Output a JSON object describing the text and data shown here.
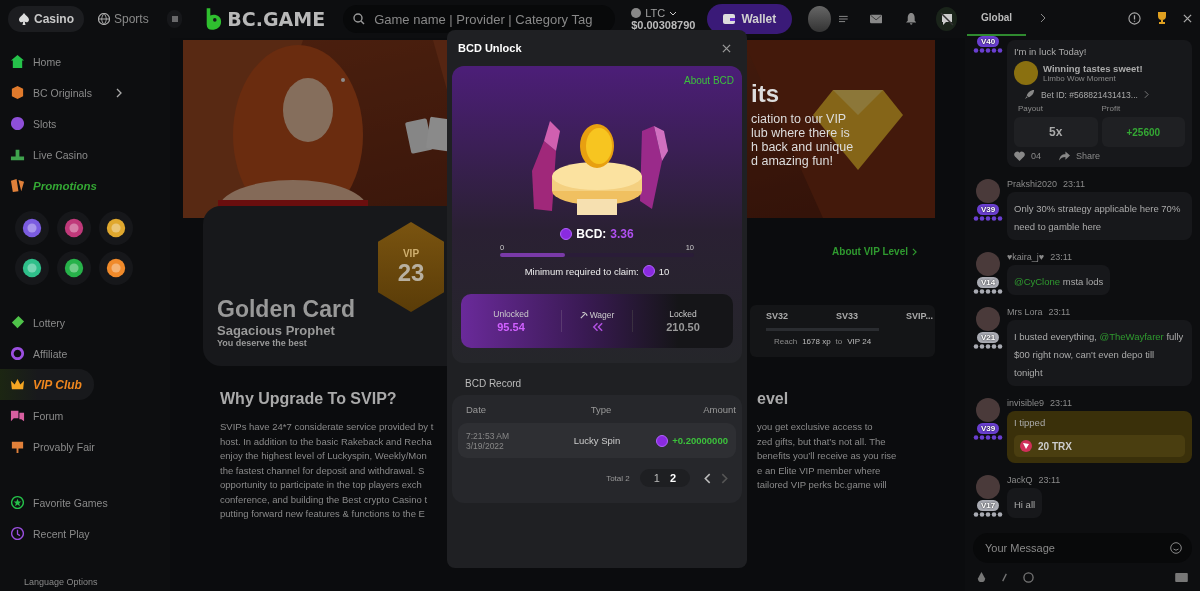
{
  "header": {
    "nav_tabs": [
      {
        "label": "Casino",
        "selected": true
      },
      {
        "label": "Sports",
        "selected": false
      }
    ],
    "logo": "BC.GAME",
    "search": {
      "placeholder": "Game name | Provider | Category Tag"
    },
    "currency": "LTC",
    "balance": "$0.00308790",
    "wallet_button": "Wallet"
  },
  "sidebar": {
    "main_items": [
      {
        "label": "Home",
        "kind": "plain",
        "expandable": false,
        "selected": false
      },
      {
        "label": "BC Originals",
        "kind": "plain",
        "expandable": true,
        "selected": false
      },
      {
        "label": "Slots",
        "kind": "plain",
        "expandable": false,
        "selected": false
      },
      {
        "label": "Live Casino",
        "kind": "plain",
        "expandable": false,
        "selected": false
      },
      {
        "label": "Promotions",
        "kind": "promo",
        "expandable": false,
        "selected": false
      }
    ],
    "more_items": [
      {
        "label": "Lottery",
        "kind": "plain",
        "selected": false
      },
      {
        "label": "Affiliate",
        "kind": "plain",
        "selected": false
      },
      {
        "label": "VIP Club",
        "kind": "vip",
        "selected": true
      },
      {
        "label": "Forum",
        "kind": "plain",
        "selected": false
      },
      {
        "label": "Provably Fair",
        "kind": "plain",
        "selected": false
      }
    ],
    "saved_items": [
      {
        "label": "Favorite Games",
        "selected": false
      },
      {
        "label": "Recent Play",
        "selected": false
      }
    ],
    "footer": "Language Options"
  },
  "banner": {
    "headline": "its",
    "lines": [
      "ciation to our VIP",
      "lub where there is",
      "h back and unique",
      "d amazing fun!"
    ]
  },
  "vip_card": {
    "title": "Golden Card",
    "subtitle": "Sagacious Prophet",
    "tagline": "You deserve the best",
    "badge_label": "VIP",
    "badge_level": "23"
  },
  "about_vip_link": "About VIP Level",
  "progress_panel": {
    "levels": [
      "SV32",
      "SV33",
      "SVIP..."
    ],
    "reach_label": "Reach",
    "xp": "1678 xp",
    "to_label": "to",
    "target": "VIP 24"
  },
  "why_section": {
    "title": "Why Upgrade To SVIP?",
    "lines": [
      "SVIPs have 24*7 considerate service provided by t",
      "host. In addition to the basic Rakeback and Recha",
      "enjoy the highest level of Luckyspin, Weekly/Mon",
      "the fastest channel for deposit and withdrawal. S",
      "opportunity to participate in the top players exch",
      "conference, and building the Best crypto Casino t",
      "putting forward new features & functions to the E"
    ]
  },
  "level_section": {
    "title": "evel",
    "lines": [
      "you get exclusive access to",
      "zed gifts, but that’s not all. The",
      "benefits you’ll receive as you rise",
      "e an Elite VIP member where",
      "tailored VIP perks bc.game will"
    ]
  },
  "modal": {
    "title": "BCD Unlock",
    "about_link": "About BCD",
    "balance_label": "BCD:",
    "balance_value": "3.36",
    "slider": {
      "min_label": "0",
      "max_label": "10",
      "level": 0.336
    },
    "claim_label": "Minimum required to claim:",
    "claim_amount": "10",
    "stats": {
      "unlocked_label": "Unlocked",
      "unlocked_value": "95.54",
      "wager_label": "Wager",
      "locked_label": "Locked",
      "locked_value": "210.50"
    },
    "record_title": "BCD Record",
    "table": {
      "columns": [
        "Date",
        "Type",
        "Amount"
      ],
      "rows": [
        {
          "time": "7:21:53 AM",
          "date": "3/19/2022",
          "type": "Lucky Spin",
          "amount": "+0.20000000"
        }
      ]
    },
    "pagination": {
      "total": "Total 2",
      "pages": [
        {
          "label": "1",
          "selected": false
        },
        {
          "label": "2",
          "selected": true
        }
      ],
      "next_disabled": true
    }
  },
  "chat": {
    "tabs": [
      {
        "label": "Global",
        "selected": true
      }
    ],
    "messages": [
      {
        "kind": "win",
        "vip": "V40",
        "color": "#6a3fd0",
        "text": "I'm in luck Today!",
        "card": {
          "title": "Winning tastes sweet!",
          "subtitle": "Limbo Wow Moment",
          "bet_id": "Bet ID: #568821431413...",
          "payout_label": "Payout",
          "profit_label": "Profit",
          "payout": "5x",
          "profit": "+25600",
          "likes": "04",
          "share": "Share"
        }
      },
      {
        "kind": "text",
        "user": "Prakshi2020",
        "time": "23:11",
        "vip": "V39",
        "color": "#6a3fd0",
        "parts": [
          {
            "text": "Only 30% strategy applicable here 70% need to gamble here",
            "mention": false
          }
        ]
      },
      {
        "kind": "text",
        "user": "♥kaira_j♥",
        "time": "23:11",
        "vip": "V14",
        "color": "#a9abb3",
        "parts": [
          {
            "text": "@CyClone",
            "mention": true
          },
          {
            "text": " msta lods",
            "mention": false
          }
        ]
      },
      {
        "kind": "text",
        "user": "Mrs Lora",
        "time": "23:11",
        "vip": "V21",
        "color": "#a9abb3",
        "parts": [
          {
            "text": "I busted everything, ",
            "mention": false
          },
          {
            "text": "@TheWayfarer",
            "mention": true
          },
          {
            "text": " fully $00 right now, can't even depo till tonight",
            "mention": false
          }
        ]
      },
      {
        "kind": "tip",
        "user": "invisible9",
        "time": "23:11",
        "vip": "V39",
        "color": "#6a3fd0",
        "parts": [
          {
            "text": "I tipped",
            "mention": false
          }
        ],
        "tip_amount": "20 TRX"
      },
      {
        "kind": "text",
        "user": "JackQ",
        "time": "23:11",
        "vip": "V17",
        "color": "#a9abb3",
        "parts": [
          {
            "text": "Hi all",
            "mention": false
          }
        ]
      }
    ],
    "input": {
      "placeholder": "Your Message"
    }
  }
}
